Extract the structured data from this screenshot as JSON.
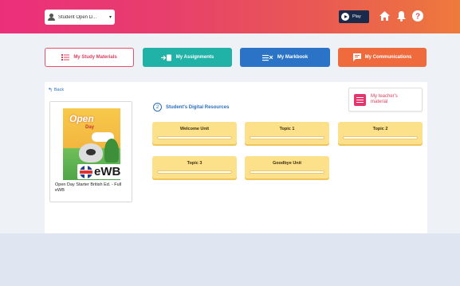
{
  "header": {
    "user_label": "Student Open D...",
    "play_label": "Play",
    "icons": [
      "home-icon",
      "bell-icon",
      "help-icon"
    ]
  },
  "nav": {
    "study_materials": "My Study Materials",
    "assignments": "My Assignments",
    "markbook": "My Markbook",
    "communications": "My Communications"
  },
  "panel": {
    "back_label": "Back",
    "section_number": "2",
    "section_title": "Student's Digital Resources",
    "teacher_material": "My teacher's material",
    "book": {
      "cover_title": "Open",
      "cover_subtitle": "Day",
      "badge": "eWB",
      "title": "Open Day Starter British Ed. - Full eWB"
    },
    "topics": [
      "Welcome Unit",
      "Topic 1",
      "Topic 2",
      "Topic 3",
      "Goodbye Unit"
    ]
  },
  "colors": {
    "header_gradient_start": "#ec2f7b",
    "header_gradient_end": "#ee7a3c",
    "study": "#e8516a",
    "assignments": "#20b2a6",
    "markbook": "#2a73c6",
    "communications": "#ef6a3c",
    "topic_tile": "#fde08a"
  }
}
